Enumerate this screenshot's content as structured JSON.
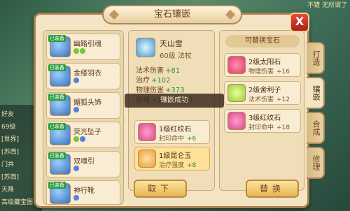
{
  "dialog": {
    "title": "宝石镶嵌",
    "close_label": "X"
  },
  "background": {
    "top_right": "不错     无所谓了",
    "chat": [
      "好友",
      "69级",
      "[世界]",
      "[苏西]",
      "门共",
      "[苏西]",
      "天降",
      "高级藏宝图"
    ]
  },
  "equipment_list": [
    {
      "name": "幽路引魂",
      "tag": "已装备",
      "gems": [
        "green",
        "green"
      ]
    },
    {
      "name": "金缕羽衣",
      "tag": "已装备",
      "gems": [
        "blue"
      ]
    },
    {
      "name": "媚狐头饰",
      "tag": "已装备",
      "gems": [
        "blue"
      ]
    },
    {
      "name": "荧光坠子",
      "tag": "已装备",
      "gems": [
        "green",
        "blue"
      ]
    },
    {
      "name": "双魂引",
      "tag": "已装备",
      "gems": [
        "blue"
      ]
    },
    {
      "name": "神行靴",
      "tag": "已装备",
      "gems": [
        "blue"
      ]
    }
  ],
  "weapon": {
    "name": "天山雪",
    "level_type": "60级 法杖",
    "stats": [
      {
        "label": "法术伤害",
        "value": "+81"
      },
      {
        "label": "治疗",
        "value": "+102"
      },
      {
        "label": "物理伤害",
        "value": "+373"
      },
      {
        "label": "敏捷",
        "value": "+1"
      },
      {
        "label": "耐力",
        "value": "+1"
      }
    ],
    "slots": [
      {
        "name": "1级红纹石",
        "stat_label": "封印命中",
        "stat_value": "+6",
        "color": "#d94a8a"
      },
      {
        "name": "1级昆仑玉",
        "stat_label": "治疗强度",
        "stat_value": "+8",
        "color": "#e8a03c"
      }
    ]
  },
  "toast": "镶嵌成功",
  "replace_panel": {
    "header": "可替换宝石",
    "items": [
      {
        "name": "2级太阳石",
        "stat_label": "物理伤害",
        "stat_value": "+16",
        "color": "#e04070"
      },
      {
        "name": "2级舍利子",
        "stat_label": "法术伤害",
        "stat_value": "+12",
        "color": "#9ccc3a"
      },
      {
        "name": "3级红纹石",
        "stat_label": "封印命中",
        "stat_value": "+18",
        "color": "#d94a8a"
      }
    ]
  },
  "buttons": {
    "remove": "取下",
    "replace": "替换"
  },
  "side_tabs": [
    "打造",
    "镶嵌",
    "合成",
    "修理"
  ],
  "active_tab": 1
}
